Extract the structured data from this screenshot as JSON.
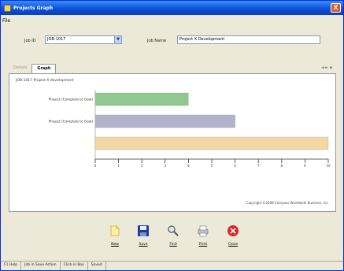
{
  "window": {
    "title": "Projects Graph",
    "close_label": "X"
  },
  "menu": {
    "file_label": "File"
  },
  "fields": {
    "job_id_label": "Job ID",
    "job_id_value": "JOB-1017",
    "job_name_label": "Job Name",
    "job_name_value": "Project X Development"
  },
  "tabs": [
    {
      "label": "Details",
      "active": false
    },
    {
      "label": "Graph",
      "active": true
    }
  ],
  "tab_nav": "◄ ► ▪",
  "chart_data": {
    "type": "bar",
    "orientation": "horizontal",
    "title": "JOB-1017 Project X development",
    "categories": [
      "Phase1 (Complete to Goal)",
      "Phase2 (Complete to Goal)",
      ""
    ],
    "values": [
      4,
      6,
      10
    ],
    "colors": [
      "#8fc98f",
      "#b4b1cc",
      "#f3d7a4"
    ],
    "xlim": [
      0,
      10
    ],
    "xticks": [
      "0",
      "1",
      "2",
      "3",
      "4",
      "5",
      "6",
      "7",
      "8",
      "9",
      "10"
    ],
    "grid": false,
    "legend": "none"
  },
  "copyright": "Copyright ©2008 Compass Worldwide Business, Inc.",
  "toolbar": {
    "new_label": "New",
    "save_label": "Save",
    "find_label": "Find",
    "print_label": "Print",
    "close_label": "Close"
  },
  "status": {
    "help": "F1 Help",
    "job": "Job in Save Action",
    "date": "Click in Box",
    "mode": "Saved"
  }
}
